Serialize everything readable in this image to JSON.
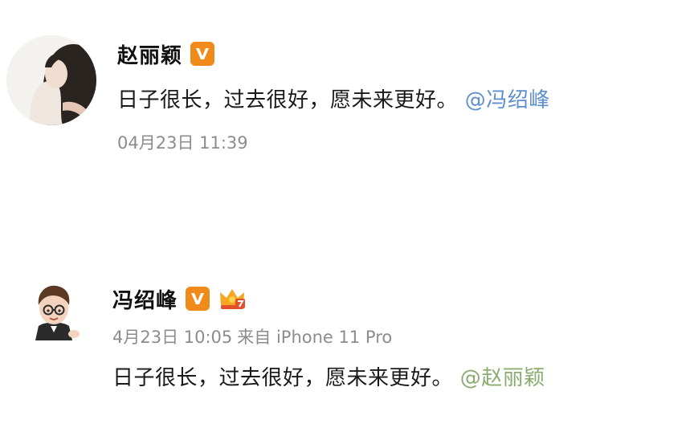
{
  "posts": [
    {
      "user": "赵丽颖",
      "content": "日子很长，过去很好，愿未来更好。",
      "mention": "@冯绍峰",
      "time": "04月23日 11:39",
      "source": ""
    },
    {
      "user": "冯绍峰",
      "content": "日子很长，过去很好，愿未来更好。",
      "mention": "@赵丽颖",
      "time": "4月23日 10:05",
      "source": "来自 iPhone 11 Pro"
    }
  ],
  "colors": {
    "verified_badge": "#f08a1b",
    "mention_blue": "#5d8fcf",
    "mention_green": "#8aac71",
    "meta_gray": "#8c8c8c"
  },
  "icons": {
    "verified": "verified-v-icon",
    "crown": "crown-vip-icon"
  }
}
